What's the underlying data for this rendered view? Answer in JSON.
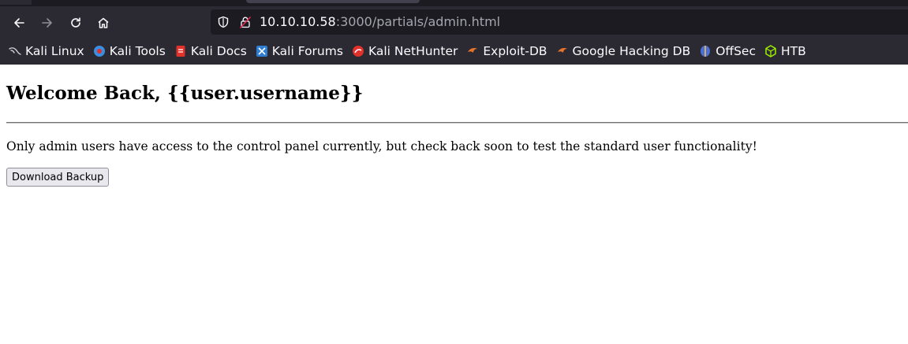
{
  "browser": {
    "url_host": "10.10.10.58",
    "url_rest": ":3000/partials/admin.html",
    "nav": {
      "back_icon": "arrow-left-icon",
      "forward_icon": "arrow-right-icon",
      "reload_icon": "reload-icon",
      "home_icon": "home-icon"
    },
    "bookmarks": [
      {
        "label": "Kali Linux",
        "icon": "kali-dragon-icon",
        "color": "#cfcfd6"
      },
      {
        "label": "Kali Tools",
        "icon": "kali-tools-icon",
        "color": "#3b8fe0"
      },
      {
        "label": "Kali Docs",
        "icon": "kali-docs-icon",
        "color": "#e0312b"
      },
      {
        "label": "Kali Forums",
        "icon": "kali-forums-icon",
        "color": "#2d7dd2"
      },
      {
        "label": "Kali NetHunter",
        "icon": "kali-nethunter-icon",
        "color": "#e0312b"
      },
      {
        "label": "Exploit-DB",
        "icon": "exploit-db-icon",
        "color": "#e8742a"
      },
      {
        "label": "Google Hacking DB",
        "icon": "ghdb-icon",
        "color": "#e8742a"
      },
      {
        "label": "OffSec",
        "icon": "offsec-icon",
        "color": "#4a6fd8"
      },
      {
        "label": "HTB",
        "icon": "htb-icon",
        "color": "#9fef00"
      }
    ]
  },
  "page": {
    "heading": "Welcome Back, {{user.username}}",
    "message": "Only admin users have access to the control panel currently, but check back soon to test the standard user functionality!",
    "download_label": "Download Backup"
  }
}
